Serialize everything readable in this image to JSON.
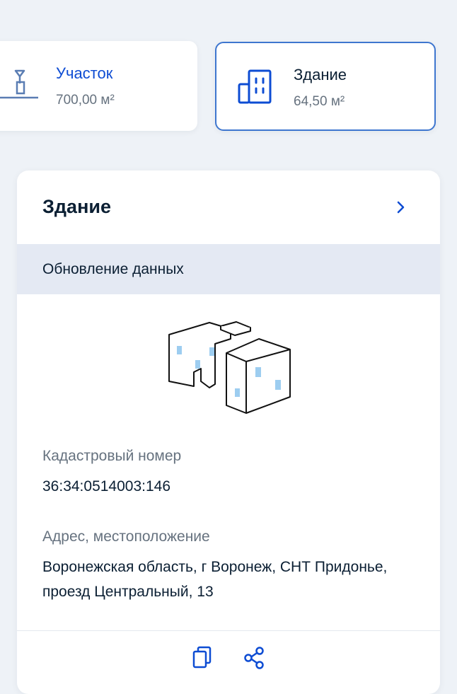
{
  "tiles": {
    "plot": {
      "title": "Участок",
      "area": "700,00 м²",
      "icon": "plot-icon"
    },
    "building": {
      "title": "Здание",
      "area": "64,50 м²",
      "icon": "building-icon"
    }
  },
  "card": {
    "title": "Здание",
    "update_notice": "Обновление данных",
    "cadastral_label": "Кадастровый номер",
    "cadastral_value": "36:34:0514003:146",
    "address_label": "Адрес, местоположение",
    "address_value": "Воронежская область, г Воронеж, СНТ Придонье, проезд Центральный, 13",
    "actions": [
      "copy-icon",
      "share-icon"
    ]
  },
  "colors": {
    "accent": "#0d4cd3",
    "selected_border": "#3e76cf",
    "background": "#eef2f7",
    "window_blue": "#9dcdf0"
  }
}
